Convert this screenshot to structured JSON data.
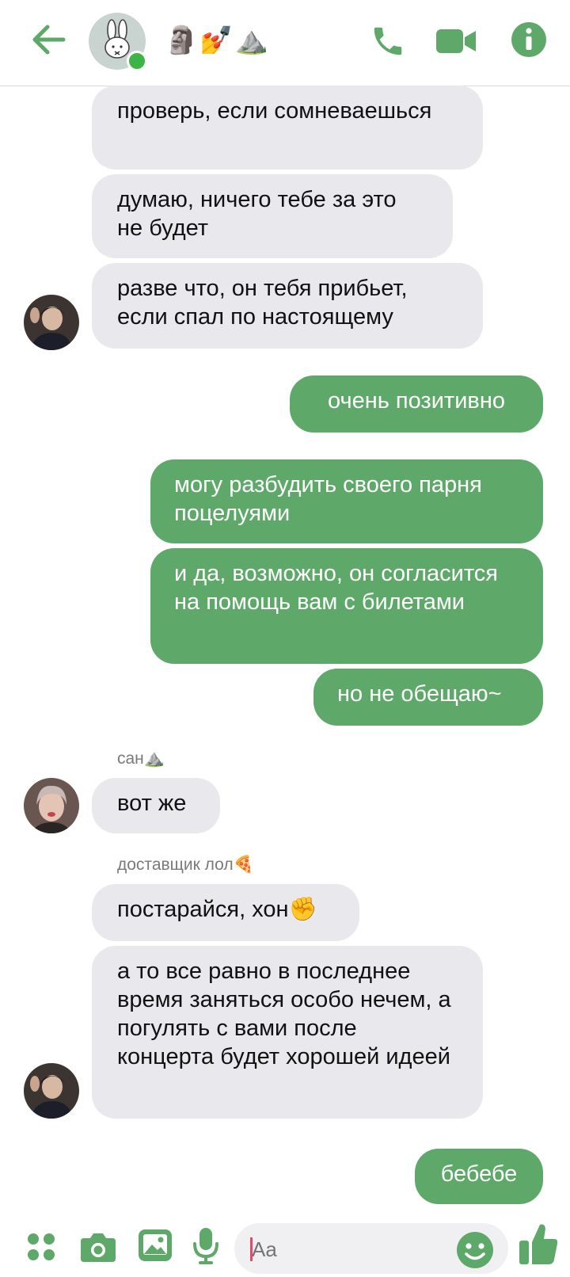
{
  "header": {
    "title_emoji": [
      "🗿",
      "💅",
      "⛰️"
    ],
    "icons": [
      "back-arrow-icon",
      "phone-icon",
      "video-camera-icon",
      "info-icon"
    ],
    "accent": "#5ea969"
  },
  "messages": [
    {
      "id": "m1",
      "dir": "in",
      "text": "проверь, если сомневаешься"
    },
    {
      "id": "m2",
      "dir": "in",
      "text": "думаю, ничего тебе за это не будет"
    },
    {
      "id": "m3",
      "dir": "in",
      "text": "разве что, он тебя прибьет, если спал по настоящему"
    },
    {
      "id": "m4",
      "dir": "out",
      "text": "очень позитивно"
    },
    {
      "id": "m5",
      "dir": "out",
      "text": "могу разбудить своего парня поцелуями"
    },
    {
      "id": "m6",
      "dir": "out",
      "text": " и да, возможно, он согласится на помощь вам с билетами"
    },
    {
      "id": "m7",
      "dir": "out",
      "text": "но не обещаю~"
    },
    {
      "id": "m8",
      "dir": "in",
      "sender": "сан⛰️",
      "text": "вот же"
    },
    {
      "id": "m9",
      "dir": "in",
      "sender": "доставщик лол🍕",
      "text": "постарайся, хон✊"
    },
    {
      "id": "m10",
      "dir": "in",
      "text": "а то все равно в последнее время заняться особо нечем, а погулять с вами после концерта будет хорошей идеей"
    },
    {
      "id": "m11",
      "dir": "out",
      "text": "бебебе"
    }
  ],
  "composer": {
    "placeholder": "Aa",
    "icons": [
      "apps-grid-icon",
      "camera-icon",
      "gallery-icon",
      "microphone-icon",
      "emoji-icon",
      "thumbs-up-icon"
    ]
  },
  "colors": {
    "incoming_bubble": "#e9e8ed",
    "outgoing_bubble": "#5ea969",
    "online": "#3db546"
  }
}
